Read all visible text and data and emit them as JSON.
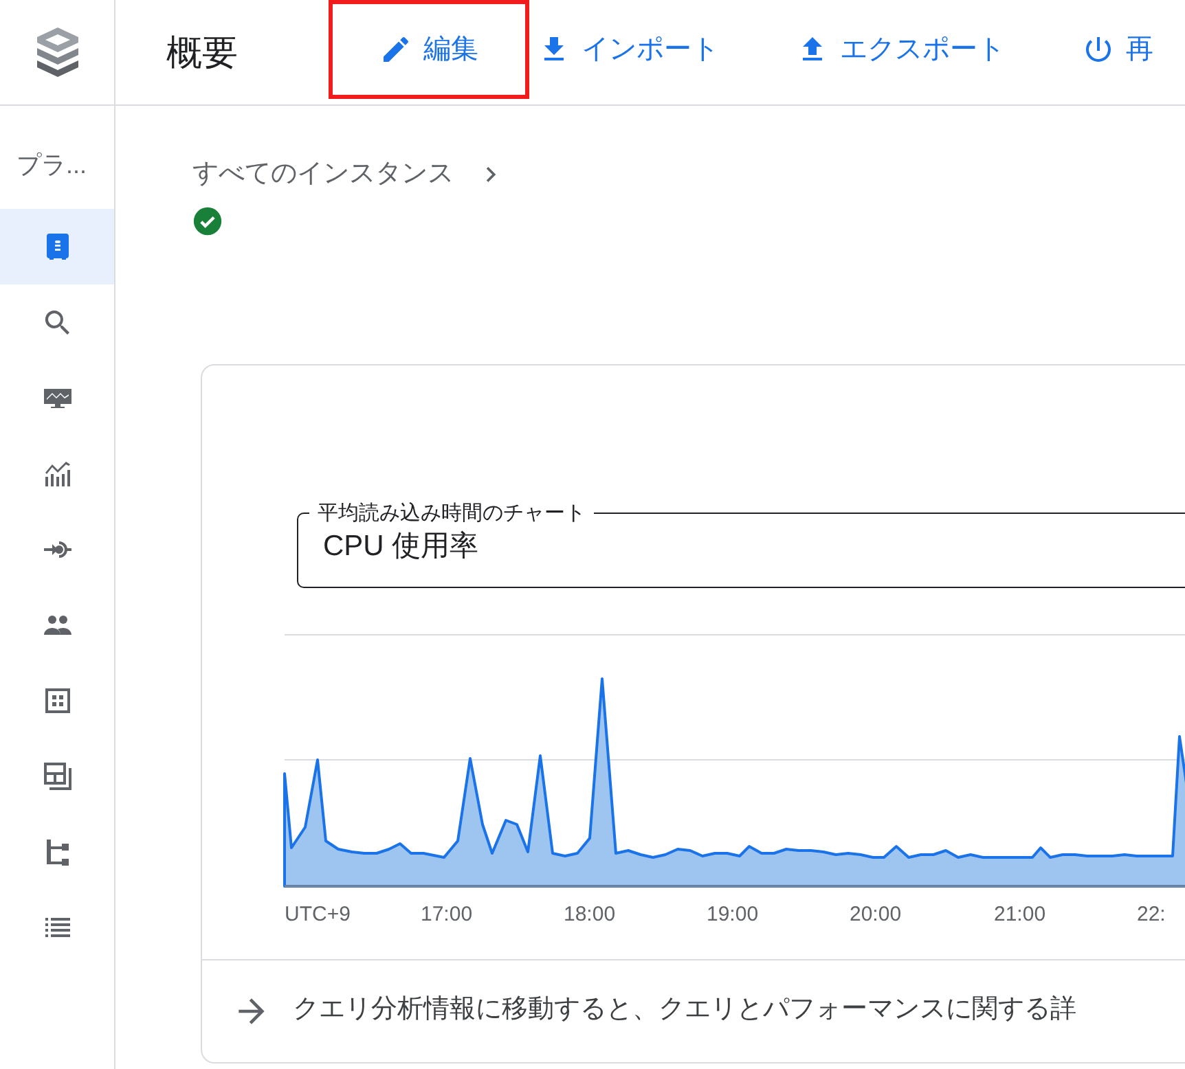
{
  "page_title": "概要",
  "toolbar": [
    {
      "kind": "edit",
      "label": "編集",
      "highlighted": true
    },
    {
      "kind": "import",
      "label": "インポート",
      "highlighted": false
    },
    {
      "kind": "export",
      "label": "エクスポート",
      "highlighted": false
    },
    {
      "kind": "restart",
      "label": "再",
      "highlighted": false
    }
  ],
  "sidebar": {
    "header": "プラ...",
    "items": [
      {
        "kind": "instance",
        "selected": true
      },
      {
        "kind": "search",
        "selected": false
      },
      {
        "kind": "monitor",
        "selected": false
      },
      {
        "kind": "chart",
        "selected": false
      },
      {
        "kind": "connect",
        "selected": false
      },
      {
        "kind": "people",
        "selected": false
      },
      {
        "kind": "grid",
        "selected": false
      },
      {
        "kind": "layout",
        "selected": false
      },
      {
        "kind": "tree",
        "selected": false
      },
      {
        "kind": "list",
        "selected": false
      }
    ]
  },
  "breadcrumb": [
    "すべてのインスタンス"
  ],
  "card": {
    "metric_field": {
      "label": "平均読み込み時間のチャート",
      "value": "CPU 使用率"
    },
    "chart": {
      "x_labels": [
        "UTC+9",
        "17:00",
        "18:00",
        "19:00",
        "20:00",
        "21:00",
        "22:"
      ]
    },
    "footer": "クエリ分析情報に移動すると、クエリとパフォーマンスに関する詳"
  }
}
